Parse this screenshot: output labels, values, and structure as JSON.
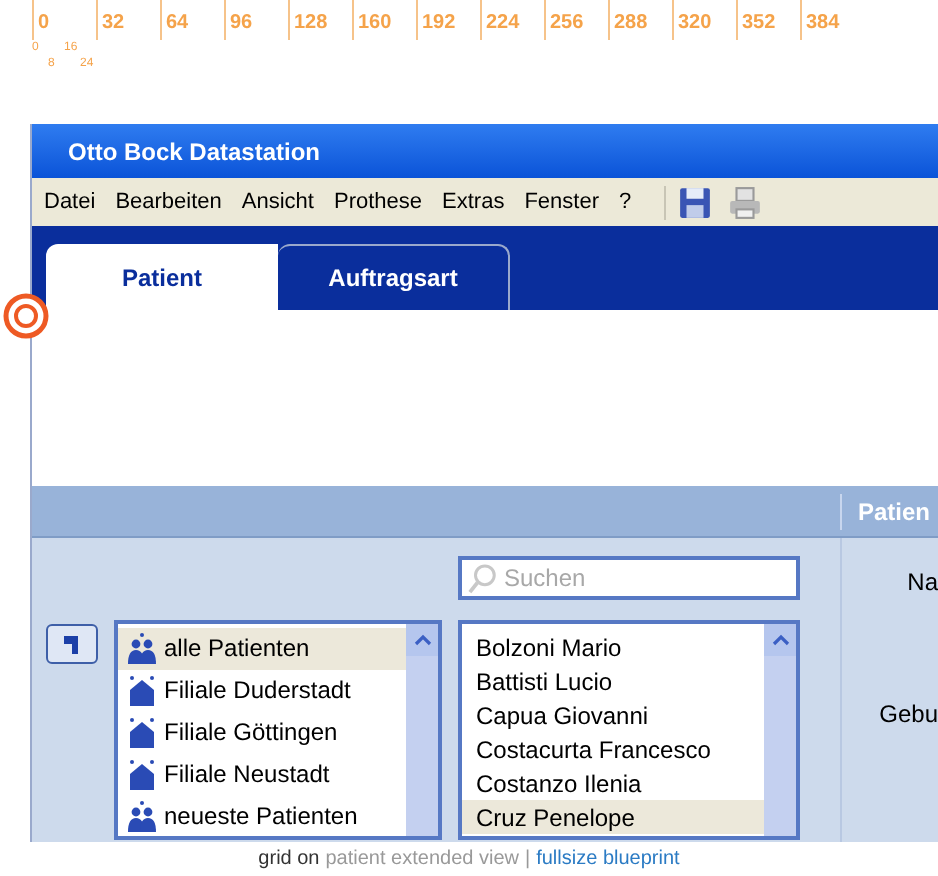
{
  "ruler": {
    "major": [
      "0",
      "32",
      "64",
      "96",
      "128",
      "160",
      "192",
      "224",
      "256",
      "288",
      "320",
      "352",
      "384"
    ],
    "minor": [
      "0",
      "8",
      "16",
      "24"
    ]
  },
  "window": {
    "title": "Otto Bock Datastation"
  },
  "menu": [
    "Datei",
    "Bearbeiten",
    "Ansicht",
    "Prothese",
    "Extras",
    "Fenster",
    "?"
  ],
  "tabs": [
    {
      "label": "Patient",
      "selected": true
    },
    {
      "label": "Auftragsart",
      "selected": false
    }
  ],
  "header": {
    "right_title": "Patien"
  },
  "search": {
    "placeholder": "Suchen"
  },
  "groups": [
    {
      "label": "alle Patienten",
      "kind": "people",
      "selected": true
    },
    {
      "label": "Filiale Duderstadt",
      "kind": "branch",
      "selected": false
    },
    {
      "label": "Filiale Göttingen",
      "kind": "branch",
      "selected": false
    },
    {
      "label": "Filiale Neustadt",
      "kind": "branch",
      "selected": false
    },
    {
      "label": "neueste Patienten",
      "kind": "people",
      "selected": false
    }
  ],
  "patients": [
    {
      "name": "Bolzoni Mario",
      "selected": false
    },
    {
      "name": "Battisti Lucio",
      "selected": false
    },
    {
      "name": "Capua Giovanni",
      "selected": false
    },
    {
      "name": "Costacurta Francesco",
      "selected": false
    },
    {
      "name": "Costanzo Ilenia",
      "selected": false
    },
    {
      "name": "Cruz Penelope",
      "selected": true
    }
  ],
  "detail_labels": [
    "Na",
    "Gebu"
  ],
  "footer": {
    "status": "grid on",
    "view": "patient extended view",
    "separator": "|",
    "link": "fullsize blueprint"
  }
}
